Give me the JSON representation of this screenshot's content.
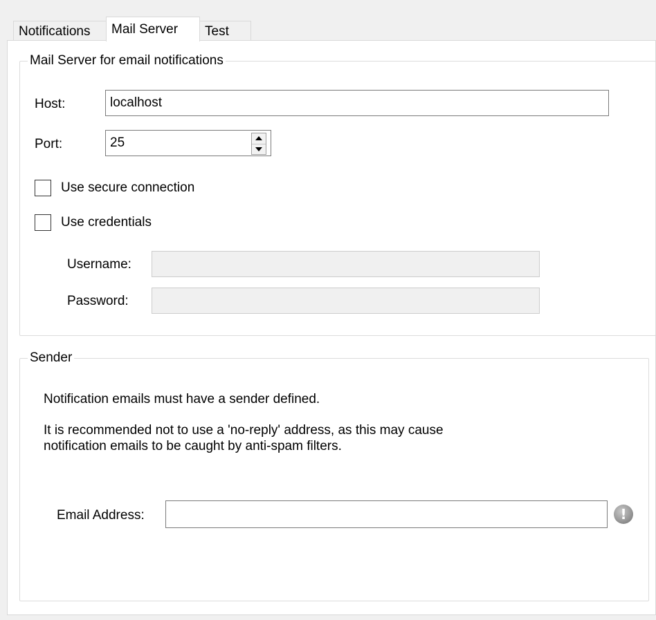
{
  "tabs": [
    {
      "label": "Notifications",
      "active": false
    },
    {
      "label": "Mail Server",
      "active": true
    },
    {
      "label": "Test",
      "active": false
    }
  ],
  "mail_server_group": {
    "title": "Mail Server for email notifications",
    "host_label": "Host:",
    "host_value": "localhost",
    "port_label": "Port:",
    "port_value": "25",
    "secure_label": "Use secure connection",
    "secure_checked": false,
    "credentials_label": "Use credentials",
    "credentials_checked": false,
    "username_label": "Username:",
    "username_value": "",
    "password_label": "Password:",
    "password_value": ""
  },
  "sender_group": {
    "title": "Sender",
    "info_line1": "Notification emails must have a sender defined.",
    "info_line2": "It is recommended not to use a 'no-reply' address, as this may cause",
    "info_line3": "notification emails to be caught by anti-spam filters.",
    "email_label": "Email Address:",
    "email_value": "",
    "warning_glyph": "!"
  },
  "icons": {
    "spin_up": "up-arrow-icon",
    "spin_down": "down-arrow-icon",
    "warning": "warning-icon"
  },
  "colors": {
    "window_bg": "#f0f0f0",
    "panel_bg": "#ffffff",
    "border": "#7a7a7a",
    "disabled_bg": "#f0f0f0",
    "warning": "#8a8a8a"
  }
}
